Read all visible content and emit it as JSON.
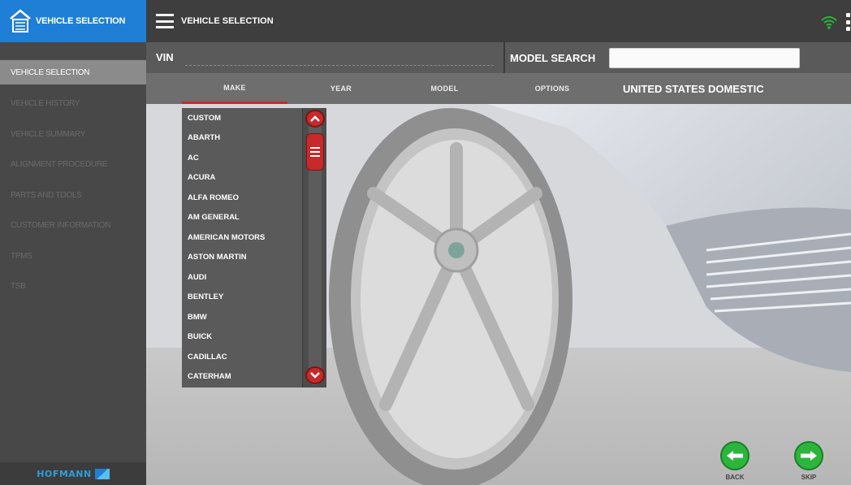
{
  "app": {
    "brand_label": "VEHICLE SELECTION",
    "header_title": "VEHICLE SELECTION",
    "accent_color": "#1f7fd6",
    "selection_color": "#c62a2a",
    "action_color": "#2cb53c"
  },
  "sidebar": {
    "items": [
      {
        "label": "VEHICLE SELECTION",
        "active": true
      },
      {
        "label": "VEHICLE HISTORY",
        "active": false
      },
      {
        "label": "VEHICLE SUMMARY",
        "active": false
      },
      {
        "label": "ALIGNMENT PROCEDURE",
        "active": false
      },
      {
        "label": "PARTS AND TOOLS",
        "active": false
      },
      {
        "label": "CUSTOMER INFORMATION",
        "active": false
      },
      {
        "label": "TPMS",
        "active": false
      },
      {
        "label": "TSB",
        "active": false
      }
    ],
    "footer_logo": "HOFMANN"
  },
  "search": {
    "vin_label": "VIN",
    "vin_value": "",
    "model_search_label": "MODEL SEARCH",
    "model_search_value": ""
  },
  "tabs": [
    {
      "label": "MAKE",
      "active": true
    },
    {
      "label": "YEAR",
      "active": false
    },
    {
      "label": "MODEL",
      "active": false
    },
    {
      "label": "OPTIONS",
      "active": false
    }
  ],
  "region_label": "UNITED STATES DOMESTIC",
  "makes": [
    "CUSTOM",
    "ABARTH",
    "AC",
    "ACURA",
    "ALFA ROMEO",
    "AM GENERAL",
    "AMERICAN MOTORS",
    "ASTON MARTIN",
    "AUDI",
    "BENTLEY",
    "BMW",
    "BUICK",
    "CADILLAC",
    "CATERHAM"
  ],
  "buttons": {
    "back_label": "BACK",
    "skip_label": "SKIP"
  },
  "icons": {
    "brand": "garage-icon",
    "menu": "hamburger-menu-icon",
    "wifi": "wifi-icon",
    "more": "kebab-menu-icon",
    "scroll_up": "chevron-up-icon",
    "scroll_down": "chevron-down-icon",
    "back": "arrow-left-icon",
    "skip": "arrow-right-icon"
  }
}
